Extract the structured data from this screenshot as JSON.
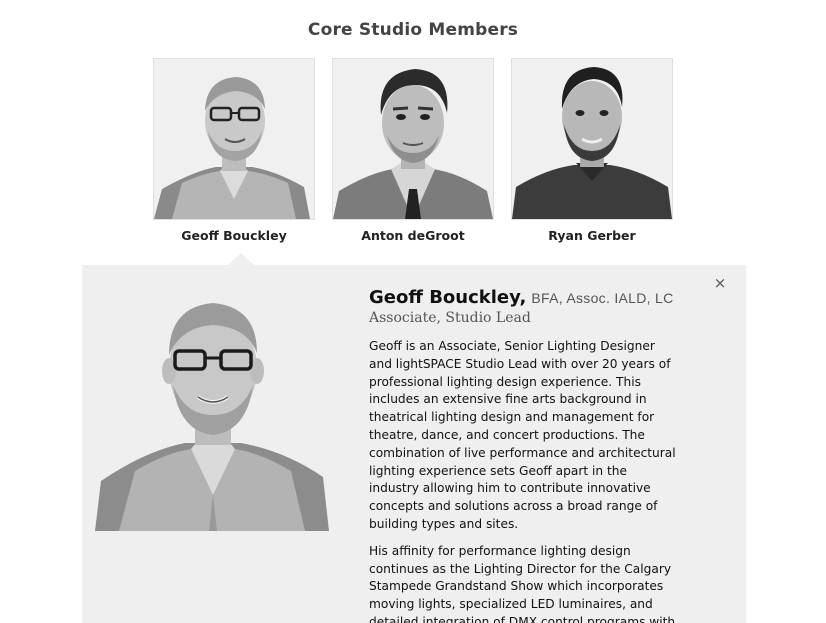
{
  "section": {
    "title": "Core Studio Members"
  },
  "members": [
    {
      "name": "Geoff Bouckley"
    },
    {
      "name": "Anton deGroot"
    },
    {
      "name": "Ryan Gerber"
    }
  ],
  "detail": {
    "name": "Geoff Bouckley,",
    "credentials": "BFA, Assoc. IALD, LC",
    "role": "Associate, Studio Lead",
    "close_icon": "×",
    "paragraphs": [
      "Geoff is an Associate, Senior Lighting Designer and lightSPACE Studio Lead with over 20 years of professional lighting design experience. This includes an extensive fine arts background in theatrical lighting design and management for theatre, dance, and concert productions. The combination of live performance and architectural lighting experience sets Geoff apart in the industry allowing him to contribute innovative concepts and solutions across a broad range of building types and sites.",
      "His affinity for performance lighting design continues as the Lighting Director for the Calgary Stampede Grandstand Show which incorporates moving lights, specialized LED luminaires, and detailed integration of DMX control programs with"
    ]
  },
  "icons": {
    "close": "close-icon"
  }
}
